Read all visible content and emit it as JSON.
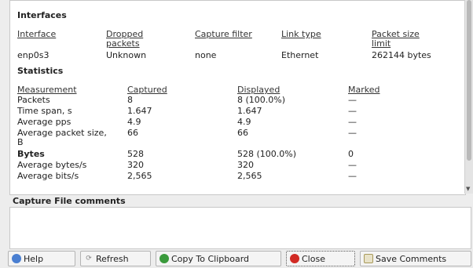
{
  "interfaces": {
    "heading": "Interfaces",
    "headers": [
      "Interface",
      "Dropped packets",
      "Capture filter",
      "Link type",
      "Packet size limit"
    ],
    "row": [
      "enp0s3",
      "Unknown",
      "none",
      "Ethernet",
      "262144 bytes"
    ]
  },
  "statistics": {
    "heading": "Statistics",
    "headers": [
      "Measurement",
      "Captured",
      "Displayed",
      "Marked"
    ],
    "rows": [
      [
        "Packets",
        "8",
        "8 (100.0%)",
        "—"
      ],
      [
        "Time span, s",
        "1.647",
        "1.647",
        "—"
      ],
      [
        "Average pps",
        "4.9",
        "4.9",
        "—"
      ],
      [
        "Average packet size, B",
        "66",
        "66",
        "—"
      ],
      [
        "Bytes",
        "528",
        "528 (100.0%)",
        "0"
      ],
      [
        "Average bytes/s",
        "320",
        "320",
        "—"
      ],
      [
        "Average bits/s",
        "2,565",
        "2,565",
        "—"
      ]
    ]
  },
  "comments": {
    "label": "Capture File comments",
    "value": ""
  },
  "buttons": {
    "help": "Help",
    "refresh": "Refresh",
    "copy": "Copy To Clipboard",
    "close": "Close",
    "save": "Save Comments"
  }
}
